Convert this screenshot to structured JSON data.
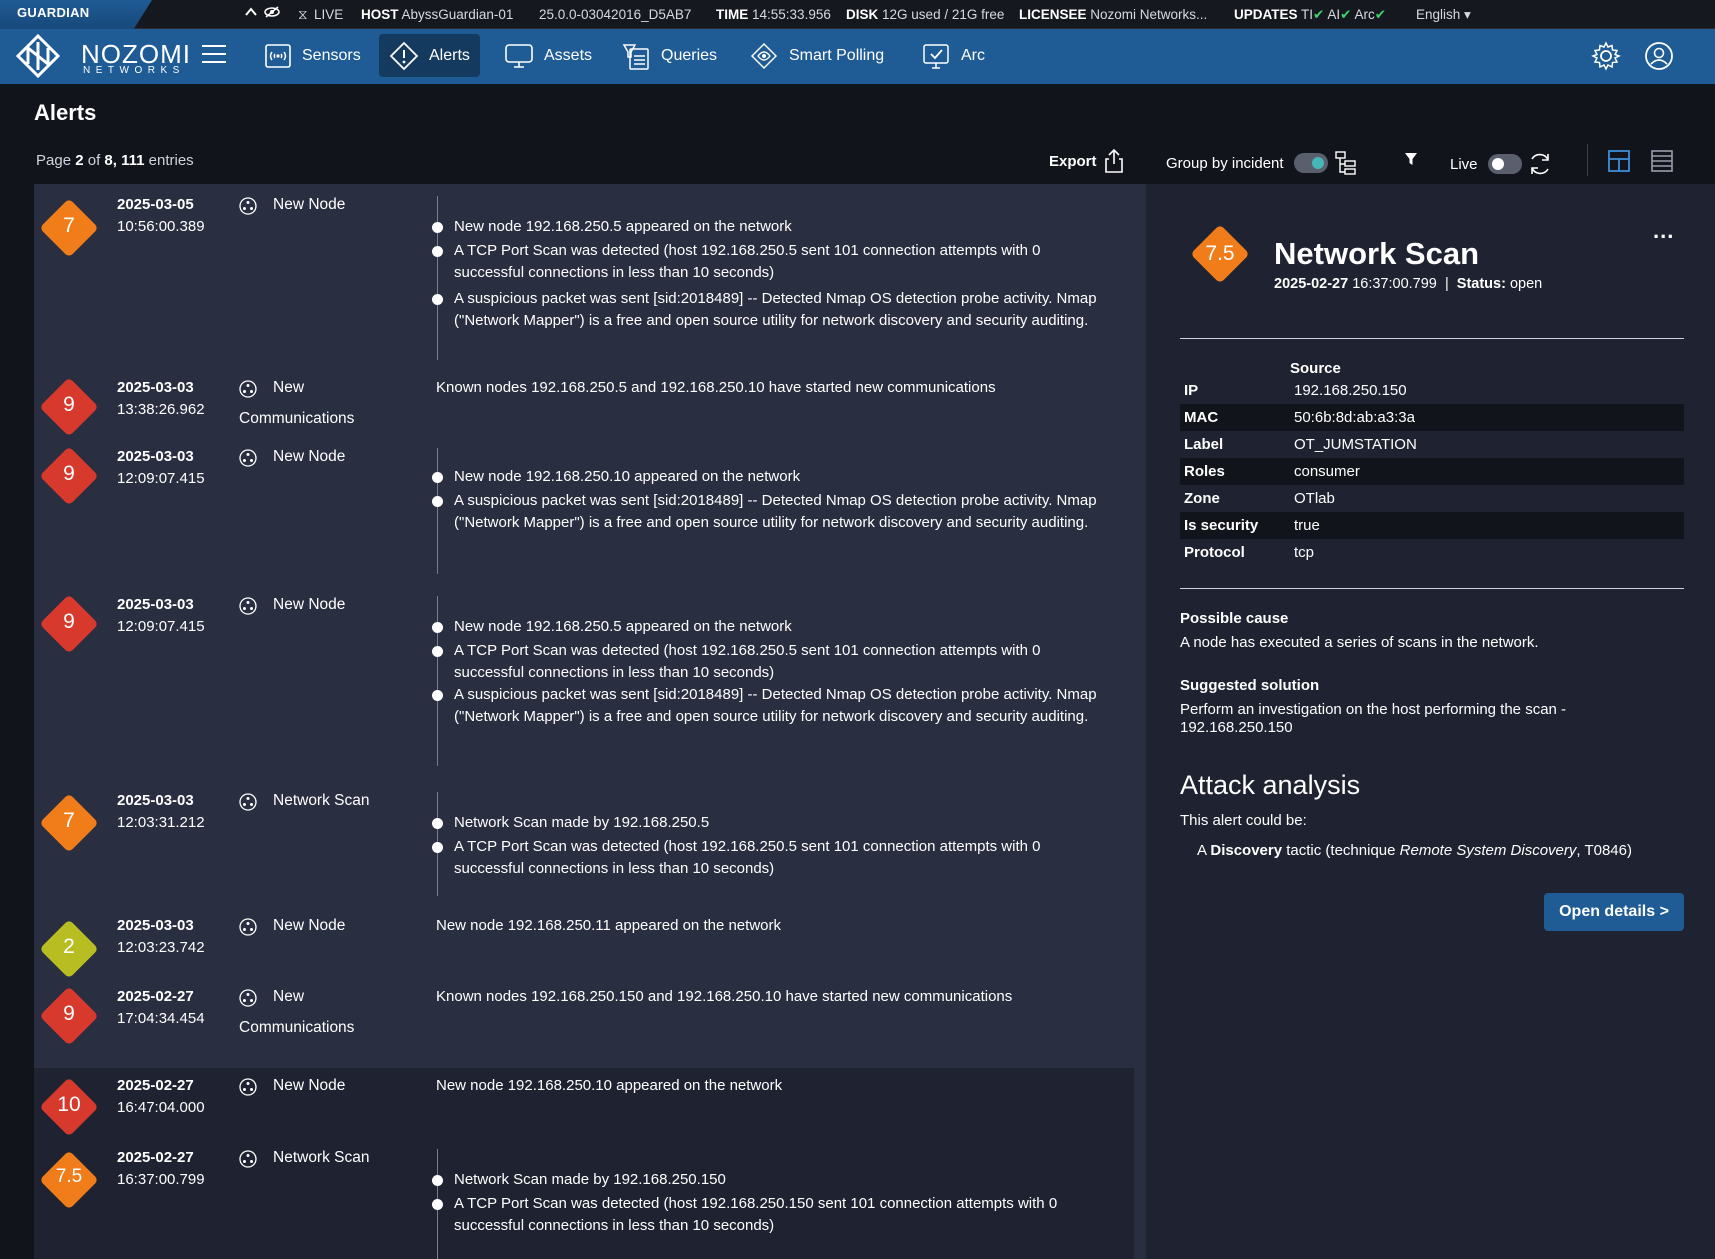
{
  "statusbar": {
    "product": "GUARDIAN",
    "live": "LIVE",
    "host_label": "HOST",
    "host_value": "AbyssGuardian-01",
    "version": "25.0.0-03042016_D5AB7",
    "time_label": "TIME",
    "time_value": "14:55:33.956",
    "disk_label": "DISK",
    "disk_value": "12G used / 21G free",
    "licensee_label": "LICENSEE",
    "licensee_value": "Nozomi Networks...",
    "updates_label": "UPDATES",
    "update_ti": "TI",
    "update_ai": "AI",
    "update_arc": "Arc",
    "check": "✔",
    "language": "English"
  },
  "logo": {
    "name": "NOZOMI",
    "sub": "NETWORKS"
  },
  "nav": {
    "items": [
      {
        "label": "Sensors",
        "icon": "sensors-icon"
      },
      {
        "label": "Alerts",
        "icon": "alert-diamond-icon"
      },
      {
        "label": "Assets",
        "icon": "monitor-icon"
      },
      {
        "label": "Queries",
        "icon": "query-icon"
      },
      {
        "label": "Smart Polling",
        "icon": "smart-polling-icon"
      },
      {
        "label": "Arc",
        "icon": "arc-icon"
      }
    ],
    "active": "Alerts"
  },
  "page": {
    "title": "Alerts",
    "page_prefix": "Page",
    "page_num": "2",
    "page_of": "of",
    "page_total": "8, 111",
    "page_suffix": "entries",
    "export": "Export",
    "group_by_incident": "Group by incident",
    "live": "Live"
  },
  "colors": {
    "nav": "#1f5b95",
    "orange": "#f07d1a",
    "red": "#d7392d",
    "yellow": "#b8bd22",
    "list_bg": "#292e40",
    "panel_bg": "#1f2331"
  },
  "alerts": [
    {
      "risk": "7",
      "date": "2025-03-05",
      "time": "10:56:00.389",
      "category": "New Node",
      "items": [
        "New node 192.168.250.5 appeared on the network",
        "A TCP Port Scan was detected (host 192.168.250.5 sent 101 connection attempts with 0 successful connections in less than 10 seconds)",
        "A suspicious packet was sent [sid:2018489] -- Detected Nmap OS detection probe activity. Nmap (\"Network Mapper\") is a free and open source utility for network discovery and security auditing."
      ]
    },
    {
      "risk": "9",
      "date": "2025-03-03",
      "time": "13:38:26.962",
      "category_a": "New",
      "category_b": "Communications",
      "description": "Known nodes 192.168.250.5 and 192.168.250.10 have started new communications"
    },
    {
      "risk": "9",
      "date": "2025-03-03",
      "time": "12:09:07.415",
      "category": "New Node",
      "items": [
        "New node 192.168.250.10 appeared on the network",
        "A suspicious packet was sent [sid:2018489] -- Detected Nmap OS detection probe activity. Nmap (\"Network Mapper\") is a free and open source utility for network discovery and security auditing."
      ]
    },
    {
      "risk": "9",
      "date": "2025-03-03",
      "time": "12:09:07.415",
      "category": "New Node",
      "items": [
        "New node 192.168.250.5 appeared on the network",
        "A TCP Port Scan was detected (host 192.168.250.5 sent 101 connection attempts with 0 successful connections in less than 10 seconds)",
        "A suspicious packet was sent [sid:2018489] -- Detected Nmap OS detection probe activity. Nmap (\"Network Mapper\") is a free and open source utility for network discovery and security auditing."
      ]
    },
    {
      "risk": "7",
      "date": "2025-03-03",
      "time": "12:03:31.212",
      "category": "Network Scan",
      "items": [
        "Network Scan made by 192.168.250.5",
        "A TCP Port Scan was detected (host 192.168.250.5 sent 101 connection attempts with 0 successful connections in less than 10 seconds)"
      ]
    },
    {
      "risk": "2",
      "date": "2025-03-03",
      "time": "12:03:23.742",
      "category": "New Node",
      "description": "New node 192.168.250.11 appeared on the network"
    },
    {
      "risk": "9",
      "date": "2025-02-27",
      "time": "17:04:34.454",
      "category_a": "New",
      "category_b": "Communications",
      "description": "Known nodes 192.168.250.150 and 192.168.250.10 have started new communications"
    },
    {
      "risk": "10",
      "date": "2025-02-27",
      "time": "16:47:04.000",
      "category": "New Node",
      "description": "New node 192.168.250.10 appeared on the network"
    },
    {
      "risk": "7.5",
      "date": "2025-02-27",
      "time": "16:37:00.799",
      "category": "Network Scan",
      "items": [
        "Network Scan made by 192.168.250.150",
        "A TCP Port Scan was detected (host 192.168.250.150 sent 101 connection attempts with 0 successful connections in less than 10 seconds)"
      ]
    }
  ],
  "detail": {
    "risk": "7.5",
    "title": "Network Scan",
    "date": "2025-02-27",
    "time": "16:37:00.799",
    "separator": "|",
    "status_label": "Status:",
    "status_value": "open",
    "more": "...",
    "source_header": "Source",
    "fields": [
      {
        "key": "IP",
        "value": "192.168.250.150"
      },
      {
        "key": "MAC",
        "value": "50:6b:8d:ab:a3:3a"
      },
      {
        "key": "Label",
        "value": "OT_JUMSTATION"
      },
      {
        "key": "Roles",
        "value": "consumer"
      },
      {
        "key": "Zone",
        "value": "OTlab"
      },
      {
        "key": "Is security",
        "value": "true"
      },
      {
        "key": "Protocol",
        "value": "tcp"
      }
    ],
    "possible_cause_label": "Possible cause",
    "possible_cause": "A node has executed a series of scans in the network.",
    "suggested_solution_label": "Suggested solution",
    "suggested_solution_a": "Perform an investigation on the host performing the scan -",
    "suggested_solution_b": "192.168.250.150",
    "attack_analysis_label": "Attack analysis",
    "could_be": "This alert could be:",
    "tactic_a": "A",
    "tactic_b": "Discovery",
    "tactic_c": "tactic (technique",
    "tactic_d": "Remote System Discovery",
    "tactic_e": ", T0846)",
    "open_details": "Open details >"
  }
}
